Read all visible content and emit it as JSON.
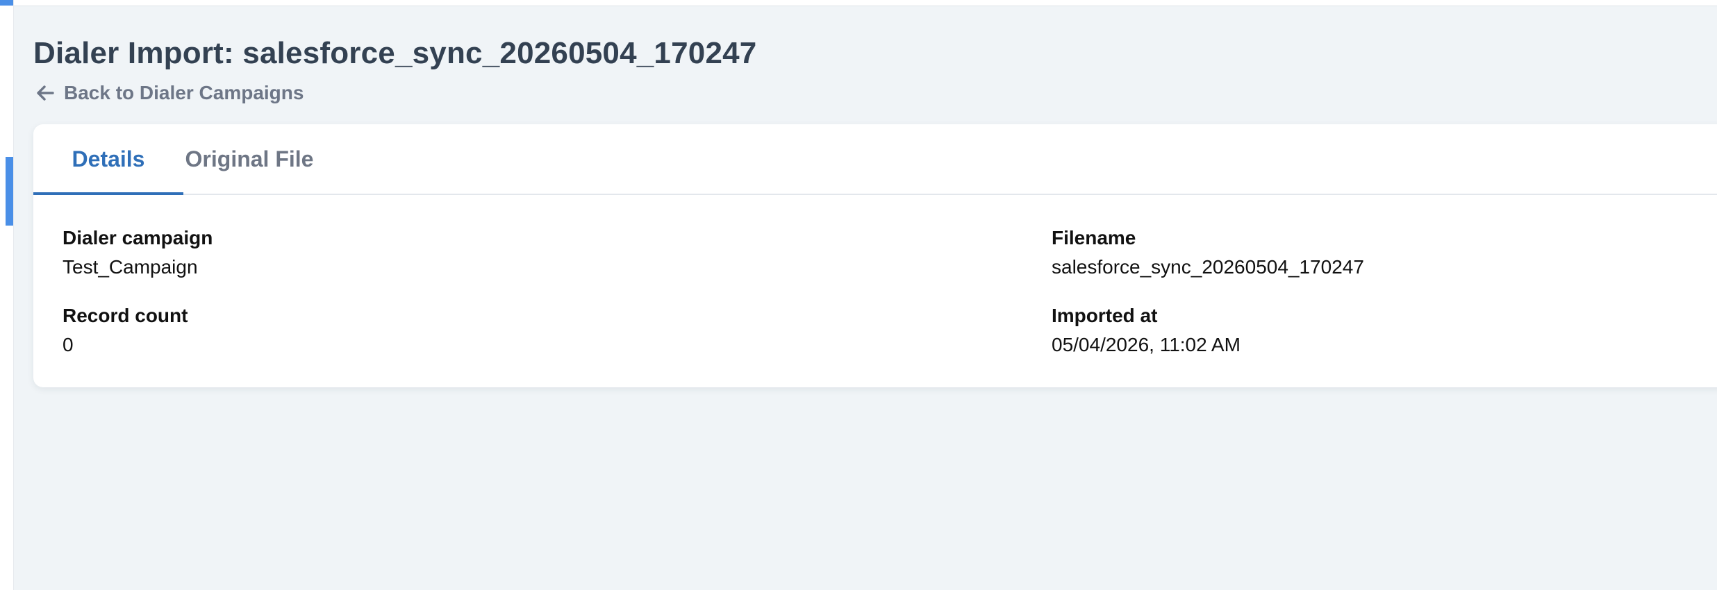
{
  "page": {
    "title": "Dialer Import: salesforce_sync_20260504_170247",
    "back_link_label": "Back to Dialer Campaigns"
  },
  "tabs": [
    {
      "label": "Details",
      "active": true
    },
    {
      "label": "Original File",
      "active": false
    }
  ],
  "details": {
    "dialer_campaign": {
      "label": "Dialer campaign",
      "value": "Test_Campaign"
    },
    "filename": {
      "label": "Filename",
      "value": "salesforce_sync_20260504_170247"
    },
    "record_count": {
      "label": "Record count",
      "value": "0"
    },
    "imported_at": {
      "label": "Imported at",
      "value": "05/04/2026, 11:02 AM"
    }
  },
  "colors": {
    "accent": "#2f6fb8",
    "rail_marker": "#4a8fe7",
    "title_text": "#334152",
    "muted_text": "#6e7685",
    "background": "#f0f4f7"
  },
  "icons": {
    "back": "arrow-left-icon"
  }
}
